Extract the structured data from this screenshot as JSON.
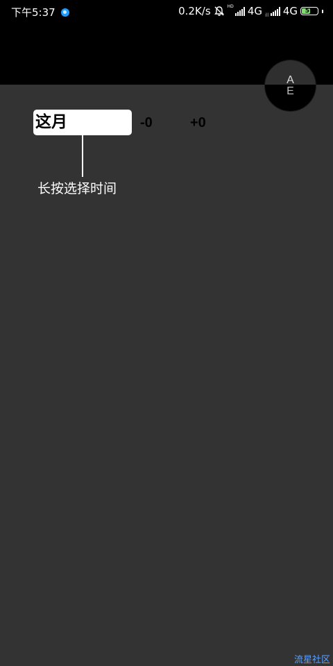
{
  "status_bar": {
    "time": "下午5:37",
    "net_speed": "0.2K/s",
    "hd_label": "HD",
    "net1": "4G",
    "net1_sub": "ill",
    "net2": "4G",
    "battery_level": "51",
    "app_icon": "app-notification-icon",
    "mute_icon": "bell-off-icon"
  },
  "ae_toggle": {
    "top_letter": "A",
    "bottom_letter": "E"
  },
  "period": {
    "current": "这月",
    "minus": "-0",
    "plus": "+0"
  },
  "hint": {
    "text": "长按选择时间"
  },
  "watermark": "流星社区",
  "colors": {
    "background": "#333333",
    "top_band": "#000000",
    "chip": "#ffffff",
    "battery": "#7ee26a"
  }
}
